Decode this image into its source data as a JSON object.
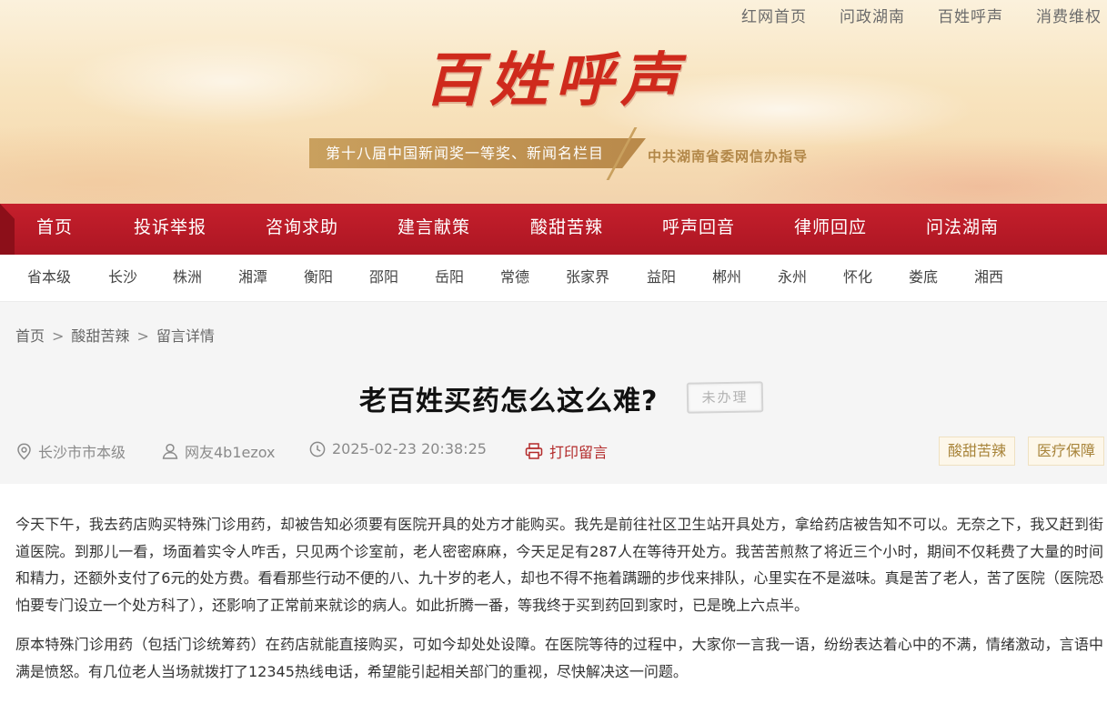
{
  "top_links": [
    "红网首页",
    "问政湖南",
    "百姓呼声",
    "消费维权"
  ],
  "logo": {
    "text": "百姓呼声"
  },
  "award": {
    "text": "第十八届中国新闻奖一等奖、新闻名栏目",
    "guide": "中共湖南省委网信办指导"
  },
  "main_nav": [
    "首页",
    "投诉举报",
    "咨询求助",
    "建言献策",
    "酸甜苦辣",
    "呼声回音",
    "律师回应",
    "问法湖南"
  ],
  "region_nav": [
    "省本级",
    "长沙",
    "株洲",
    "湘潭",
    "衡阳",
    "邵阳",
    "岳阳",
    "常德",
    "张家界",
    "益阳",
    "郴州",
    "永州",
    "怀化",
    "娄底",
    "湘西"
  ],
  "breadcrumb": [
    "首页",
    "酸甜苦辣",
    "留言详情"
  ],
  "post": {
    "title": "老百姓买药怎么这么难?",
    "status": "未办理",
    "location": "长沙市市本级",
    "author": "网友4b1ezox",
    "time": "2025-02-23 20:38:25",
    "print_label": "打印留言",
    "tags": [
      "酸甜苦辣",
      "医疗保障"
    ],
    "paragraphs": [
      "今天下午，我去药店购买特殊门诊用药，却被告知必须要有医院开具的处方才能购买。我先是前往社区卫生站开具处方，拿给药店被告知不可以。无奈之下，我又赶到街道医院。到那儿一看，场面着实令人咋舌，只见两个诊室前，老人密密麻麻，今天足足有287人在等待开处方。我苦苦煎熬了将近三个小时，期间不仅耗费了大量的时间和精力，还额外支付了6元的处方费。看看那些行动不便的八、九十岁的老人，却也不得不拖着蹒跚的步伐来排队，心里实在不是滋味。真是苦了老人，苦了医院（医院恐怕要专门设立一个处方科了），还影响了正常前来就诊的病人。如此折腾一番，等我终于买到药回到家时，已是晚上六点半。",
      "原本特殊门诊用药（包括门诊统筹药）在药店就能直接购买，可如今却处处设障。在医院等待的过程中，大家你一言我一语，纷纷表达着心中的不满，情绪激动，言语中满是愤怒。有几位老人当场就拨打了12345热线电话，希望能引起相关部门的重视，尽快解决这一问题。"
    ]
  },
  "colors": {
    "nav_red": "#b81b27",
    "brand_gold": "#c9a05e",
    "print_red": "#b32a2a",
    "tag_gold": "#a8843a"
  }
}
